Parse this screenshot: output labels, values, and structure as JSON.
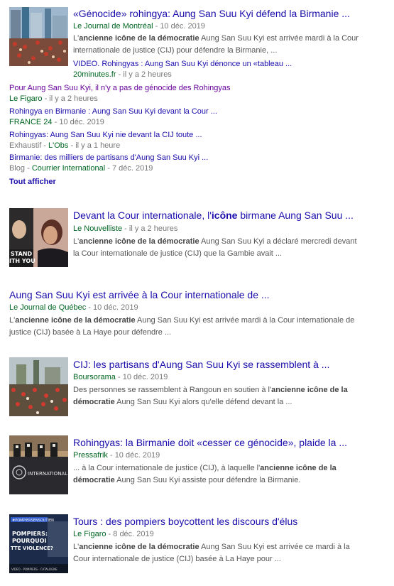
{
  "cluster": {
    "main": {
      "title": "«Génocide» rohingya: Aung San Suu Kyi défend la Birmanie ...",
      "source": "Le Journal de Montréal",
      "time": "10 déc. 2019",
      "snippet_bold": "ancienne icône de la démocratie",
      "snippet_pre": "L'",
      "snippet_post": " Aung San Suu Kyi est arrivée mardi à la Cour",
      "snippet_line2": "internationale de justice (CIJ) pour défendre la Birmanie, ..."
    },
    "video": {
      "title": "VIDEO. Rohingyas : Aung San Suu Kyi dénonce un «tableau ...",
      "source": "20minutes.fr",
      "time": "il y a 2 heures"
    },
    "subs": [
      {
        "title": "Pour Aung San Suu Kyi, il n'y a pas de génocide des Rohingyas",
        "prefix": "",
        "source": "Le Figaro",
        "time": "il y a 2 heures"
      },
      {
        "title": "Rohingya en Birmanie : Aung San Suu Kyi devant la Cour ...",
        "prefix": "",
        "source": "FRANCE 24",
        "time": "10 déc. 2019"
      },
      {
        "title": "Rohingyas: Aung San Suu Kyi nie devant la CIJ toute ...",
        "prefix": "Exhaustif",
        "source": "L'Obs",
        "time": "il y a 1 heure"
      },
      {
        "title": "Birmanie: des milliers de partisans d'Aung San Suu Kyi ...",
        "prefix": "Blog",
        "source": "Courrier International",
        "time": "7 déc. 2019"
      }
    ],
    "show_all": "Tout afficher"
  },
  "results": [
    {
      "title_pre": "Devant la Cour internationale, l'",
      "title_bold": "icône",
      "title_post": " birmane Aung San Suu ...",
      "source": "Le Nouvelliste",
      "time": "il y a 2 heures",
      "snippet_pre": "L'",
      "snippet_bold": "ancienne icône de la démocratie",
      "snippet_post": " Aung San Suu Kyi a déclaré mercredi devant",
      "snippet_line2": "la Cour internationale de justice (CIJ) que la Gambie avait ..."
    },
    {
      "title": "Aung San Suu Kyi est arrivée à la Cour internationale de ...",
      "source": "Le Journal de Québec",
      "time": "10 déc. 2019",
      "snippet_pre": "L'",
      "snippet_bold": "ancienne icône de la démocratie",
      "snippet_post": " Aung San Suu Kyi est arrivée mardi à la Cour internationale de",
      "snippet_line2": "justice (CIJ) basée à La Haye pour défendre ..."
    },
    {
      "title": "CIJ: les partisans d'Aung San Suu Kyi se rassemblent à ...",
      "source": "Boursorama",
      "time": "10 déc. 2019",
      "snippet_pre": "Des personnes se rassemblent à Rangoun en soutien à l'",
      "snippet_bold": "ancienne icône de la",
      "snippet_line2_bold": "démocratie",
      "snippet_line2": " Aung San Suu Kyi alors qu'elle défend devant la ..."
    },
    {
      "title": "Rohingyas: la Birmanie doit «cesser ce génocide», plaide la ...",
      "source": "Pressafrik",
      "time": "10 déc. 2019",
      "snippet_pre": "... à la Cour internationale de justice (CIJ), à laquelle l'",
      "snippet_bold": "ancienne icône de la",
      "snippet_line2_bold": "démocratie",
      "snippet_line2": " Aung San Suu Kyi assiste pour défendre la Birmanie."
    },
    {
      "title": "Tours : des pompiers boycottent les discours d'élus",
      "source": "Le Figaro",
      "time": "8 déc. 2019",
      "snippet_pre": "L'",
      "snippet_bold": "ancienne icône de la démocratie",
      "snippet_post": " Aung San Suu Kyi est arrivée ce mardi à la",
      "snippet_line2": "Cour internationale de justice (CIJ) basée à La Haye pour ..."
    }
  ],
  "thumb_text": {
    "stand": "STAND",
    "with_you": "ITH YOU",
    "international": "INTERNATIONAL",
    "hashtag": "#POMPIERSENSOUTIEN",
    "pompiers": "POMPIERS:",
    "pourquoi": "POURQUOI",
    "violence": "TTE VIOLENCE?",
    "footer": "VIDEO · POMPIERS · CATALOGNE"
  },
  "colors": {
    "link": "#1a0dab",
    "source": "#006621",
    "visited": "#660099",
    "meta": "#777777"
  }
}
